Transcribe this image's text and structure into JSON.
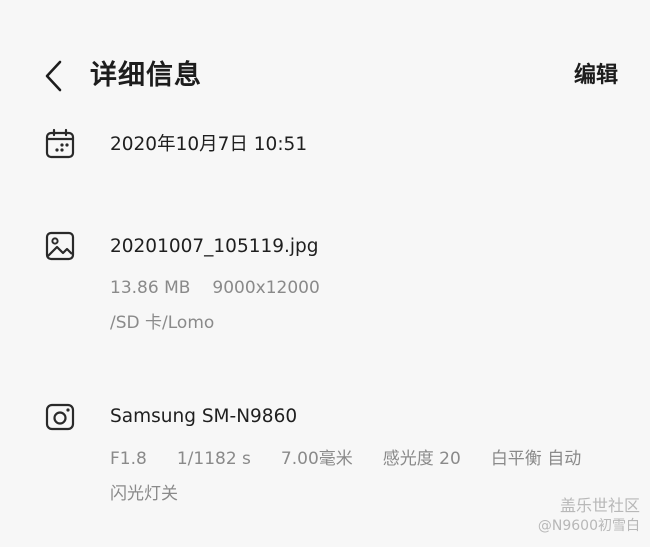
{
  "header": {
    "title": "详细信息",
    "edit_label": "编辑"
  },
  "date_section": {
    "icon": "calendar-icon",
    "datetime": "2020年10月7日 10:51"
  },
  "file_section": {
    "icon": "image-icon",
    "filename": "20201007_105119.jpg",
    "size": "13.86 MB",
    "resolution": "9000x12000",
    "path": "/SD 卡/Lomo"
  },
  "camera_section": {
    "icon": "camera-icon",
    "model": "Samsung SM-N9860",
    "aperture": "F1.8",
    "shutter": "1/1182 s",
    "focal_length": "7.00毫米",
    "iso": "感光度 20",
    "white_balance": "白平衡 自动",
    "flash": "闪光灯关"
  },
  "watermark": {
    "brand": "盖乐世社区",
    "user": "@N9600初雪白"
  }
}
